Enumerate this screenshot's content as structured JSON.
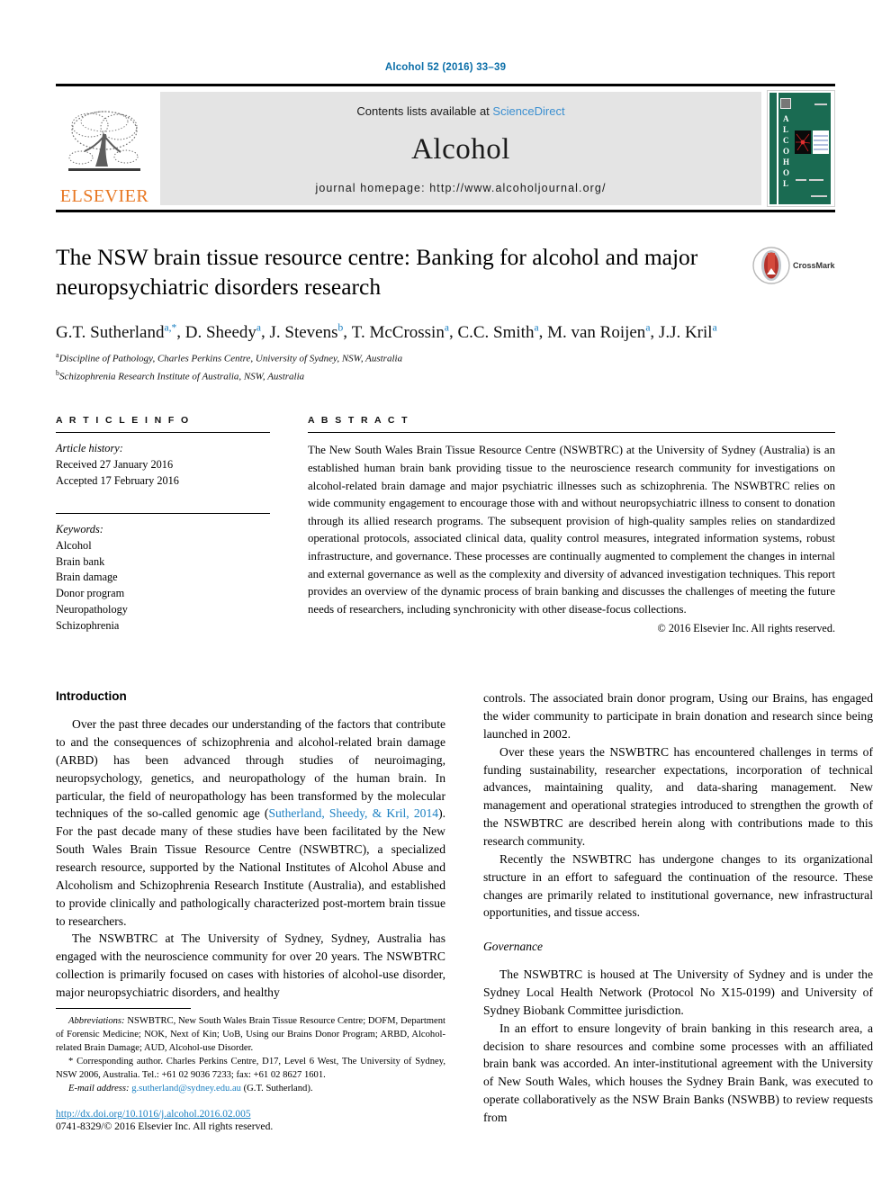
{
  "running_head": "Alcohol 52 (2016) 33–39",
  "masthead": {
    "publisher_name": "ELSEVIER",
    "contents_prefix": "Contents lists available at ",
    "contents_link": "ScienceDirect",
    "journal_name": "Alcohol",
    "homepage": "journal homepage: http://www.alcoholjournal.org/",
    "cover_title": "ALCOHOL"
  },
  "title": "The NSW brain tissue resource centre: Banking for alcohol and major neuropsychiatric disorders research",
  "crossmark_label": "CrossMark",
  "authors": [
    {
      "name": "G.T. Sutherland",
      "marks": "a,*"
    },
    {
      "name": "D. Sheedy",
      "marks": "a"
    },
    {
      "name": "J. Stevens",
      "marks": "b"
    },
    {
      "name": "T. McCrossin",
      "marks": "a"
    },
    {
      "name": "C.C. Smith",
      "marks": "a"
    },
    {
      "name": "M. van Roijen",
      "marks": "a"
    },
    {
      "name": "J.J. Kril",
      "marks": "a"
    }
  ],
  "affiliations": [
    {
      "mark": "a",
      "text": "Discipline of Pathology, Charles Perkins Centre, University of Sydney, NSW, Australia"
    },
    {
      "mark": "b",
      "text": "Schizophrenia Research Institute of Australia, NSW, Australia"
    }
  ],
  "article_info": {
    "heading": "A R T I C L E  I N F O",
    "history_label": "Article history:",
    "history": [
      "Received 27 January 2016",
      "Accepted 17 February 2016"
    ],
    "keywords_label": "Keywords:",
    "keywords": [
      "Alcohol",
      "Brain bank",
      "Brain damage",
      "Donor program",
      "Neuropathology",
      "Schizophrenia"
    ]
  },
  "abstract": {
    "heading": "A B S T R A C T",
    "text": "The New South Wales Brain Tissue Resource Centre (NSWBTRC) at the University of Sydney (Australia) is an established human brain bank providing tissue to the neuroscience research community for investigations on alcohol-related brain damage and major psychiatric illnesses such as schizophrenia. The NSWBTRC relies on wide community engagement to encourage those with and without neuropsychiatric illness to consent to donation through its allied research programs. The subsequent provision of high-quality samples relies on standardized operational protocols, associated clinical data, quality control measures, integrated information systems, robust infrastructure, and governance. These processes are continually augmented to complement the changes in internal and external governance as well as the complexity and diversity of advanced investigation techniques. This report provides an overview of the dynamic process of brain banking and discusses the challenges of meeting the future needs of researchers, including synchronicity with other disease-focus collections.",
    "copyright": "© 2016 Elsevier Inc. All rights reserved."
  },
  "body": {
    "left": {
      "heading": "Introduction",
      "paragraphs": [
        "Over the past three decades our understanding of the factors that contribute to and the consequences of schizophrenia and alcohol-related brain damage (ARBD) has been advanced through studies of neuroimaging, neuropsychology, genetics, and neuropathology of the human brain. In particular, the field of neuropathology has been transformed by the molecular techniques of the so-called genomic age (Sutherland, Sheedy, & Kril, 2014). For the past decade many of these studies have been facilitated by the New South Wales Brain Tissue Resource Centre (NSWBTRC), a specialized research resource, supported by the National Institutes of Alcohol Abuse and Alcoholism and Schizophrenia Research Institute (Australia), and established to provide clinically and pathologically characterized post-mortem brain tissue to researchers.",
        "The NSWBTRC at The University of Sydney, Sydney, Australia has engaged with the neuroscience community for over 20 years. The NSWBTRC collection is primarily focused on cases with histories of alcohol-use disorder, major neuropsychiatric disorders, and healthy"
      ],
      "citation": "Sutherland, Sheedy, & Kril, 2014"
    },
    "right": {
      "paragraphs": [
        "controls. The associated brain donor program, Using our Brains, has engaged the wider community to participate in brain donation and research since being launched in 2002.",
        "Over these years the NSWBTRC has encountered challenges in terms of funding sustainability, researcher expectations, incorporation of technical advances, maintaining quality, and data-sharing management. New management and operational strategies introduced to strengthen the growth of the NSWBTRC are described herein along with contributions made to this research community.",
        "Recently the NSWBTRC has undergone changes to its organizational structure in an effort to safeguard the continuation of the resource. These changes are primarily related to institutional governance, new infrastructural opportunities, and tissue access."
      ],
      "subheading": "Governance",
      "paragraphs2": [
        "The NSWBTRC is housed at The University of Sydney and is under the Sydney Local Health Network (Protocol No X15-0199) and University of Sydney Biobank Committee jurisdiction.",
        "In an effort to ensure longevity of brain banking in this research area, a decision to share resources and combine some processes with an affiliated brain bank was accorded. An inter-institutional agreement with the University of New South Wales, which houses the Sydney Brain Bank, was executed to operate collaboratively as the NSW Brain Banks (NSWBB) to review requests from"
      ]
    }
  },
  "footnotes": {
    "abbrev_label": "Abbreviations:",
    "abbrev_text": " NSWBTRC, New South Wales Brain Tissue Resource Centre; DOFM, Department of Forensic Medicine; NOK, Next of Kin; UoB, Using our Brains Donor Program; ARBD, Alcohol-related Brain Damage; AUD, Alcohol-use Disorder.",
    "corresponding": "* Corresponding author. Charles Perkins Centre, D17, Level 6 West, The University of Sydney, NSW 2006, Australia. Tel.: +61 02 9036 7233; fax: +61 02 8627 1601.",
    "email_label": "E-mail address:",
    "email": "g.sutherland@sydney.edu.au",
    "email_suffix": " (G.T. Sutherland).",
    "doi": "http://dx.doi.org/10.1016/j.alcohol.2016.02.005",
    "issn": "0741-8329/© 2016 Elsevier Inc. All rights reserved."
  },
  "colors": {
    "link": "#1a7fc1",
    "elsevier_orange": "#E87722",
    "cover_green": "#1a6b52"
  }
}
